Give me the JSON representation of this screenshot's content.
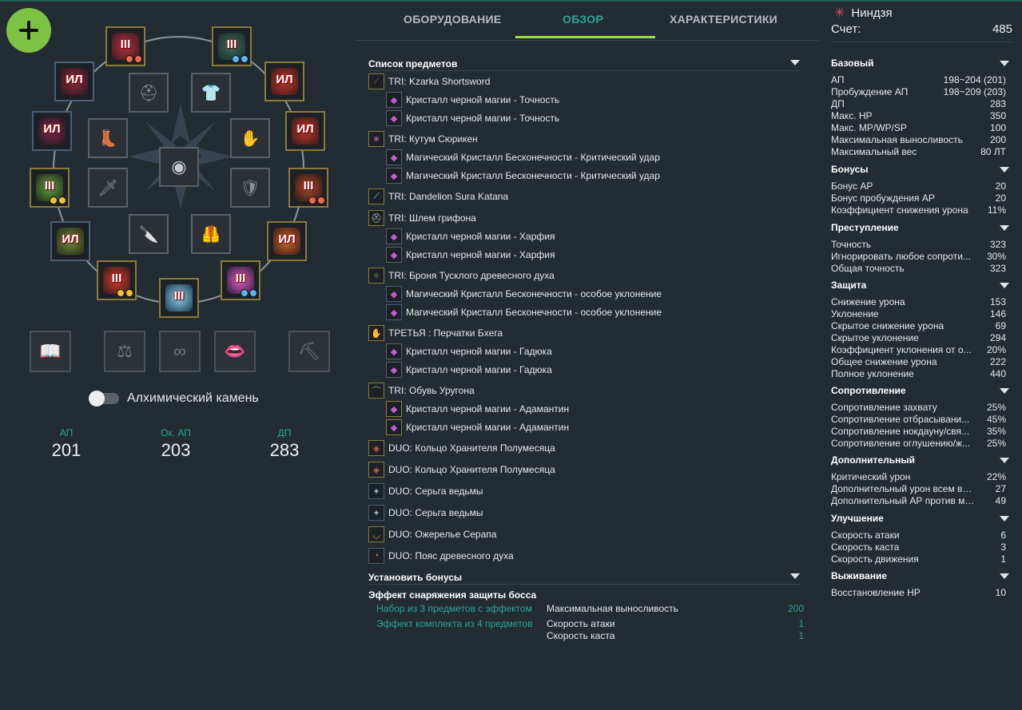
{
  "left": {
    "add_label": "+",
    "slots": [
      {
        "id": "helm",
        "level": "III",
        "dots": [
          "red",
          "red"
        ]
      },
      {
        "id": "armor",
        "level": "III",
        "dots": [
          "blue",
          "blue"
        ]
      },
      {
        "id": "ring1",
        "level": "ИЛ",
        "dots": []
      },
      {
        "id": "ring2",
        "level": "ИЛ",
        "dots": []
      },
      {
        "id": "earring1",
        "level": "ИЛ",
        "dots": []
      },
      {
        "id": "earring2",
        "level": "ИЛ",
        "dots": []
      },
      {
        "id": "weapon1",
        "level": "III",
        "dots": [
          "yellow",
          "yellow"
        ]
      },
      {
        "id": "gloves",
        "level": "III",
        "dots": [
          "red",
          "red"
        ]
      },
      {
        "id": "belt",
        "level": "ИЛ",
        "dots": []
      },
      {
        "id": "necklace",
        "level": "ИЛ",
        "dots": []
      },
      {
        "id": "subweapon",
        "level": "III",
        "dots": [
          "yellow",
          "yellow"
        ]
      },
      {
        "id": "awakening",
        "level": "III",
        "dots": []
      },
      {
        "id": "shuriken",
        "level": "III",
        "dots": [
          "blue",
          "blue"
        ]
      }
    ],
    "toggle_label": "Алхимический камень",
    "stats": [
      {
        "label": "АП",
        "value": "201"
      },
      {
        "label": "Ок. АП",
        "value": "203"
      },
      {
        "label": "ДП",
        "value": "283"
      }
    ]
  },
  "tabs": [
    {
      "label": "ОБОРУДОВАНИЕ"
    },
    {
      "label": "ОБЗОР"
    },
    {
      "label": "ХАРАКТЕРИСТИКИ"
    }
  ],
  "overview": {
    "items_title": "Список предметов",
    "items": [
      {
        "text": "TRI: Kzarka Shortsword",
        "indent": false,
        "border": "gold",
        "icon": "sword-icon"
      },
      {
        "text": "Кристалл черной магии - Точность",
        "indent": true,
        "border": "grey",
        "icon": "crystal-icon"
      },
      {
        "text": "Кристалл черной магии - Точность",
        "indent": true,
        "border": "grey",
        "icon": "crystal-icon"
      },
      {
        "text": "TRI: Кутум Сюрикен",
        "indent": false,
        "border": "gold",
        "icon": "shuriken-icon"
      },
      {
        "text": "Магический Кристалл Бесконечности - Критический удар",
        "indent": true,
        "border": "grey",
        "icon": "crystal-icon"
      },
      {
        "text": "Магический Кристалл Бесконечности - Критический удар",
        "indent": true,
        "border": "grey",
        "icon": "crystal-icon"
      },
      {
        "text": "TRI: Dandelion Sura Katana",
        "indent": false,
        "border": "gold",
        "icon": "katana-icon"
      },
      {
        "text": "TRI: Шлем грифона",
        "indent": false,
        "border": "gold",
        "icon": "helmet-icon"
      },
      {
        "text": "Кристалл черной магии - Харфия",
        "indent": true,
        "border": "grey",
        "icon": "crystal-icon"
      },
      {
        "text": "Кристалл черной магии - Харфия",
        "indent": true,
        "border": "grey",
        "icon": "crystal-icon"
      },
      {
        "text": "TRI: Броня Тусклого древесного духа",
        "indent": false,
        "border": "gold",
        "icon": "armor-icon"
      },
      {
        "text": "Магический Кристалл Бесконечности - особое уклонение",
        "indent": true,
        "border": "blue",
        "icon": "crystal-icon"
      },
      {
        "text": "Магический Кристалл Бесконечности - особое уклонение",
        "indent": true,
        "border": "blue",
        "icon": "crystal-icon"
      },
      {
        "text": "ТРЕТЬЯ : Перчатки Бхега",
        "indent": false,
        "border": "gold",
        "icon": "gloves-icon"
      },
      {
        "text": "Кристалл черной магии - Гадюка",
        "indent": true,
        "border": "grey",
        "icon": "crystal-icon"
      },
      {
        "text": "Кристалл черной магии - Гадюка",
        "indent": true,
        "border": "grey",
        "icon": "crystal-icon"
      },
      {
        "text": "TRI: Обувь Уругона",
        "indent": false,
        "border": "gold",
        "icon": "boots-icon"
      },
      {
        "text": "Кристалл черной магии - Адамантин",
        "indent": true,
        "border": "gold",
        "icon": "crystal-icon"
      },
      {
        "text": "Кристалл черной магии - Адамантин",
        "indent": true,
        "border": "gold",
        "icon": "crystal-icon"
      },
      {
        "text": "DUO: Кольцо Хранителя Полумесяца",
        "indent": false,
        "border": "gold",
        "icon": "ring-icon"
      },
      {
        "text": "DUO: Кольцо Хранителя Полумесяца",
        "indent": false,
        "border": "gold",
        "icon": "ring-icon"
      },
      {
        "text": "DUO: Серьга ведьмы",
        "indent": false,
        "border": "blue",
        "icon": "earring-icon"
      },
      {
        "text": "DUO: Серьга ведьмы",
        "indent": false,
        "border": "blue",
        "icon": "earring-icon"
      },
      {
        "text": "DUO: Ожерелье Серапа",
        "indent": false,
        "border": "gold",
        "icon": "necklace-icon"
      },
      {
        "text": "DUO: Пояс древесного духа",
        "indent": false,
        "border": "blue",
        "icon": "belt-icon"
      }
    ],
    "set_title": "Установить бонусы",
    "set_bonus": {
      "title": "Эффект снаряжения защиты босса",
      "rows": [
        {
          "name": "Набор из 3 предметов с эффектом",
          "stat": "Максимальная выносливость",
          "value": "200"
        },
        {
          "name": "Эффект комплекта из 4 предметов",
          "stat": "Скорость атаки",
          "value": "1"
        },
        {
          "name": "",
          "stat": "Скорость каста",
          "value": "1"
        }
      ]
    }
  },
  "right": {
    "class_name": "Ниндзя",
    "score_label": "Счет:",
    "score_value": "485",
    "groups": [
      {
        "title": "Базовый",
        "rows": [
          {
            "k": "АП",
            "v": "198~204 (201)"
          },
          {
            "k": "Пробуждение АП",
            "v": "198~209 (203)"
          },
          {
            "k": "ДП",
            "v": "283"
          },
          {
            "k": "Макс. HP",
            "v": "350"
          },
          {
            "k": "Макс. MP/WP/SP",
            "v": "100"
          },
          {
            "k": "Максимальная выносливость",
            "v": "200"
          },
          {
            "k": "Максимальный вес",
            "v": "80 ЛТ"
          }
        ]
      },
      {
        "title": "Бонусы",
        "rows": [
          {
            "k": "Бонус AP",
            "v": "20"
          },
          {
            "k": "Бонус пробуждения AP",
            "v": "20"
          },
          {
            "k": "Коэффициент снижения урона",
            "v": "11%"
          }
        ]
      },
      {
        "title": "Преступление",
        "rows": [
          {
            "k": "Точность",
            "v": "323"
          },
          {
            "k": "Игнорировать любое сопроти...",
            "v": "30%"
          },
          {
            "k": "Общая точность",
            "v": "323"
          }
        ]
      },
      {
        "title": "Защита",
        "rows": [
          {
            "k": "Снижение урона",
            "v": "153"
          },
          {
            "k": "Уклонение",
            "v": "146"
          },
          {
            "k": "Скрытое снижение урона",
            "v": "69"
          },
          {
            "k": "Скрытое уклонение",
            "v": "294"
          },
          {
            "k": "Коэффициент уклонения от о...",
            "v": "20%"
          },
          {
            "k": "Общее снижение урона",
            "v": "222"
          },
          {
            "k": "Полное уклонение",
            "v": "440"
          }
        ]
      },
      {
        "title": "Сопротивление",
        "rows": [
          {
            "k": "Сопротивление захвату",
            "v": "25%"
          },
          {
            "k": "Сопротивление отбрасывани...",
            "v": "45%"
          },
          {
            "k": "Сопротивление нокдауну/свя...",
            "v": "35%"
          },
          {
            "k": "Сопротивление оглушению/ж...",
            "v": "25%"
          }
        ]
      },
      {
        "title": "Дополнительный",
        "rows": [
          {
            "k": "Критический урон",
            "v": "22%"
          },
          {
            "k": "Дополнительный урон всем ви...",
            "v": "27"
          },
          {
            "k": "Дополнительный АР против мо...",
            "v": "49"
          }
        ]
      },
      {
        "title": "Улучшение",
        "rows": [
          {
            "k": "Скорость атаки",
            "v": "6"
          },
          {
            "k": "Скорость каста",
            "v": "3"
          },
          {
            "k": "Скорость движения",
            "v": "1"
          }
        ]
      },
      {
        "title": "Выживание",
        "rows": [
          {
            "k": "Восстановление HP",
            "v": "10"
          }
        ]
      }
    ]
  },
  "colors": {
    "accent": "#2aa79a",
    "add_button": "#7dc242",
    "tab_underline": "#9fdc4a",
    "slot_gold": "#8a7a3c",
    "slot_blue": "#46607a"
  }
}
